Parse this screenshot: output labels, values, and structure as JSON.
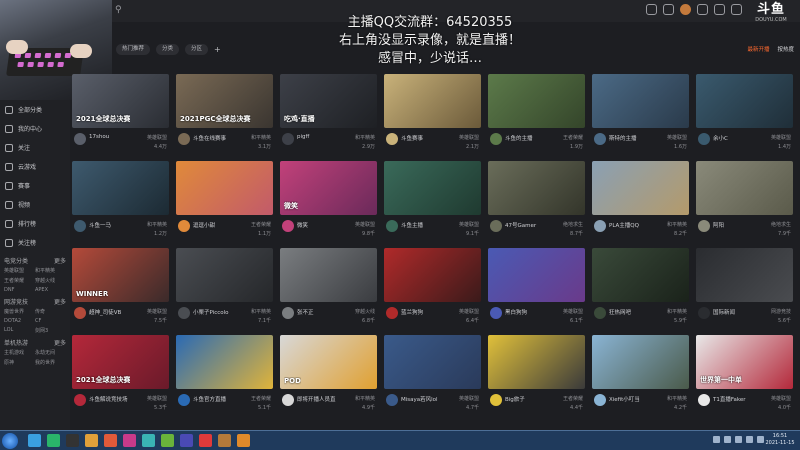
{
  "overlay": {
    "line1": "主播QQ交流群：64520355",
    "line2": "右上角没显示录像，就是直播！",
    "line3": "感冒中，少说话…"
  },
  "logo": {
    "text": "斗鱼",
    "sub": "DOUYU.COM"
  },
  "sidebar": {
    "items": [
      "全部分类",
      "我的中心",
      "关注",
      "云游戏",
      "赛事",
      "视频",
      "排行榜",
      "关注榜"
    ],
    "groups": [
      {
        "title": "电竞分类",
        "more": "更多",
        "links": [
          "英雄联盟",
          "和平精英",
          "王者荣耀",
          "穿越火线",
          "DNF",
          "APEX"
        ]
      },
      {
        "title": "网游竞技",
        "more": "更多",
        "links": [
          "魔兽世界",
          "传奇",
          "DOTA2",
          "CF",
          "LOL",
          "剑网3"
        ]
      },
      {
        "title": "单机热游",
        "more": "更多",
        "links": [
          "主机游戏",
          "永劫无间",
          "原神",
          "我的世界"
        ]
      }
    ]
  },
  "filters": [
    "热门推荐",
    "分类",
    "分区"
  ],
  "right_links": {
    "hot": "最新开播",
    "hot_label": "按热度"
  },
  "cards": [
    {
      "label": "2021全球总决赛",
      "name": "17shou",
      "cat": "英雄联盟",
      "hot": "4.4万",
      "color": "#5a5f6a",
      "color2": "#2a2d33"
    },
    {
      "label": "2021PGC全球总决赛",
      "name": "斗鱼在线赛事",
      "cat": "和平精英",
      "hot": "3.1万",
      "color": "#7a6a55",
      "color2": "#3a3530"
    },
    {
      "label": "吃鸡·直播",
      "name": "pigff",
      "cat": "和平精英",
      "hot": "2.9万",
      "color": "#3d4048",
      "color2": "#1e2024"
    },
    {
      "label": "",
      "name": "斗鱼赛事",
      "cat": "英雄联盟",
      "hot": "2.1万",
      "color": "#c9b27a",
      "color2": "#6b5a3a"
    },
    {
      "label": "",
      "name": "斗鱼的主播",
      "cat": "王者荣耀",
      "hot": "1.9万",
      "color": "#5c7a4a",
      "color2": "#34452a"
    },
    {
      "label": "",
      "name": "斯特的主播",
      "cat": "英雄联盟",
      "hot": "1.6万",
      "color": "#4b6a86",
      "color2": "#2a3a4a"
    },
    {
      "label": "",
      "name": "余小C",
      "cat": "英雄联盟",
      "hot": "1.4万",
      "color": "#3a5a6e",
      "color2": "#1f2e38"
    },
    {
      "label": "",
      "name": "斗鱼一马",
      "cat": "和平精英",
      "hot": "1.2万",
      "color": "#3e5a6e",
      "color2": "#1c2a33"
    },
    {
      "label": "",
      "name": "逗逗小甜",
      "cat": "王者荣耀",
      "hot": "1.1万",
      "color": "#e08a3a",
      "color2": "#c25a6a"
    },
    {
      "label": "微笑",
      "name": "微笑",
      "cat": "英雄联盟",
      "hot": "9.8千",
      "color": "#c2417a",
      "color2": "#6a2a5a"
    },
    {
      "label": "",
      "name": "斗鱼主播",
      "cat": "英雄联盟",
      "hot": "9.1千",
      "color": "#3a6a5a",
      "color2": "#1f3a30"
    },
    {
      "label": "",
      "name": "47号Gamer",
      "cat": "绝地求生",
      "hot": "8.7千",
      "color": "#6a6d5a",
      "color2": "#33352a"
    },
    {
      "label": "",
      "name": "PLA主播QQ",
      "cat": "和平精英",
      "hot": "8.2千",
      "color": "#8aa0b4",
      "color2": "#b49a6a"
    },
    {
      "label": "",
      "name": "阿阳",
      "cat": "绝地求生",
      "hot": "7.9千",
      "color": "#8a8a7a",
      "color2": "#5a5a4a"
    },
    {
      "label": "WINNER",
      "name": "超神_司徒VB",
      "cat": "英雄联盟",
      "hot": "7.5千",
      "color": "#b44a3a",
      "color2": "#3a2a2a"
    },
    {
      "label": "",
      "name": "小栗子Piccolo",
      "cat": "和平精英",
      "hot": "7.1千",
      "color": "#4a4d52",
      "color2": "#25272a"
    },
    {
      "label": "",
      "name": "张不正",
      "cat": "穿越火线",
      "hot": "6.8千",
      "color": "#7a7d80",
      "color2": "#3a3c40"
    },
    {
      "label": "",
      "name": "蓝兰狗狗",
      "cat": "英雄联盟",
      "hot": "6.4千",
      "color": "#b02a2a",
      "color2": "#3a1a1a"
    },
    {
      "label": "",
      "name": "黑白狗狗",
      "cat": "英雄联盟",
      "hot": "6.1千",
      "color": "#4a5ab4",
      "color2": "#6a3a8a"
    },
    {
      "label": "",
      "name": "狂热网吧",
      "cat": "和平精英",
      "hot": "5.9千",
      "color": "#3a4a3a",
      "color2": "#1a221a"
    },
    {
      "label": "",
      "name": "国际新闻",
      "cat": "网游竞技",
      "hot": "5.6千",
      "color": "#2a2c30",
      "color2": "#4a4c50"
    },
    {
      "label": "2021全球总决赛",
      "name": "斗鱼解说竞技场",
      "cat": "英雄联盟",
      "hot": "5.3千",
      "color": "#b4283a",
      "color2": "#6a1a2a"
    },
    {
      "label": "",
      "name": "斗鱼官方直播",
      "cat": "王者荣耀",
      "hot": "5.1千",
      "color": "#2a6ab4",
      "color2": "#e0b43a"
    },
    {
      "label": "POD",
      "name": "即将开播人员直",
      "cat": "和平精英",
      "hot": "4.9千",
      "color": "#d8d8d8",
      "color2": "#e0a030"
    },
    {
      "label": "",
      "name": "Misaya若风lol",
      "cat": "英雄联盟",
      "hot": "4.7千",
      "color": "#3a5a8a",
      "color2": "#2a3a5a"
    },
    {
      "label": "",
      "name": "Big旅子",
      "cat": "王者荣耀",
      "hot": "4.4千",
      "color": "#e0c03a",
      "color2": "#3a3a3a"
    },
    {
      "label": "",
      "name": "Xiefit小叮当",
      "cat": "和平精英",
      "hot": "4.2千",
      "color": "#8ab4d4",
      "color2": "#4a5a4a"
    },
    {
      "label": "世界第一中单",
      "name": "T1直播Faker",
      "cat": "英雄联盟",
      "hot": "4.0千",
      "color": "#e8e8e8",
      "color2": "#b4283a"
    }
  ],
  "taskbar": {
    "time": "16:51",
    "date": "2021-11-15"
  },
  "colors": {
    "accent": "#ff6a2f",
    "bg": "#1d1e22"
  }
}
